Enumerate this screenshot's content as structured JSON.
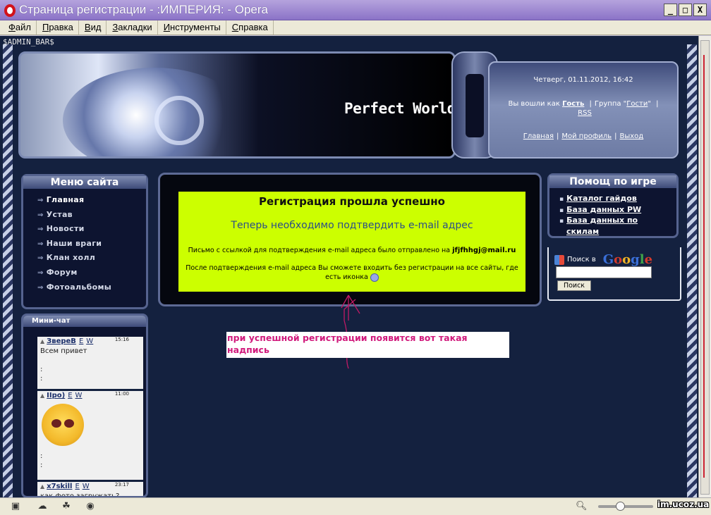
{
  "window": {
    "title": "Страница регистрации - :ИМПЕРИЯ: - Opera",
    "controls": {
      "minimize": "_",
      "maximize": "□",
      "close": "X"
    }
  },
  "menubar": [
    {
      "u": "Ф",
      "rest": "айл"
    },
    {
      "u": "П",
      "rest": "равка"
    },
    {
      "u": "В",
      "rest": "ид"
    },
    {
      "u": "З",
      "rest": "акладки"
    },
    {
      "u": "И",
      "rest": "нструменты"
    },
    {
      "u": "С",
      "rest": "правка"
    }
  ],
  "page": {
    "admin_bar": "$ADMIN_BAR$",
    "header": {
      "site_title": "Perfect World"
    },
    "userpanel": {
      "datetime": "Четверг, 01.11.2012, 16:42",
      "logged_in_as": "Вы вошли как",
      "guest": "Гость",
      "group_label": "Группа \"",
      "group": "Гости",
      "group_end": "\"",
      "rss": "RSS",
      "nav": [
        "Главная",
        "Мой профиль",
        "Выход"
      ]
    },
    "site_menu": {
      "title": "Меню сайта",
      "items": [
        "Главная",
        "Устав",
        "Новости",
        "Наши враги",
        "Клан холл",
        "Форум",
        "Фотоальбомы"
      ]
    },
    "message": {
      "title": "Регистрация прошла успешно",
      "subtitle": "Теперь необходимо подтвердить e-mail адрес",
      "p1": "Письмо с ссылкой для подтверждения e-mail адреса было отправлено на",
      "email": "jfjfhhgj@mail.ru",
      "p2": "После подтверждения e-mail адреса Вы сможете входить без регистрации на все сайты, где есть иконка"
    },
    "annotation": "при успешной регистрации появится вот такая надпись",
    "help": {
      "title": "Помощ по игре",
      "items": [
        "Каталог гайдов",
        "База данных PW",
        "База данных по скилам"
      ]
    },
    "search": {
      "label": "Поиск в",
      "google": [
        "G",
        "o",
        "o",
        "g",
        "l",
        "e"
      ],
      "input_value": "",
      "button": "Поиск"
    },
    "minichat": {
      "title": "Мини-чат",
      "messages": [
        {
          "user": "ЗвереВ",
          "e": "E",
          "w": "W",
          "time": "15:16",
          "text": "Всем привет",
          "lines": [
            ":",
            ":"
          ]
        },
        {
          "user": "IIро)",
          "e": "E",
          "w": "W",
          "time": "11:00",
          "text": "",
          "lines": [
            ":",
            ":"
          ]
        },
        {
          "user": "x7skill",
          "e": "E",
          "w": "W",
          "time": "23:17",
          "text": "как фото загружать?",
          "lines": []
        }
      ]
    }
  },
  "statusbar": {
    "watermark": "im.ucoz.ua",
    "zoom_level": 0.4
  },
  "colors": {
    "message_bg": "#ccff00",
    "annotation_text": "#d11a7c",
    "page_bg": "#14213f"
  }
}
